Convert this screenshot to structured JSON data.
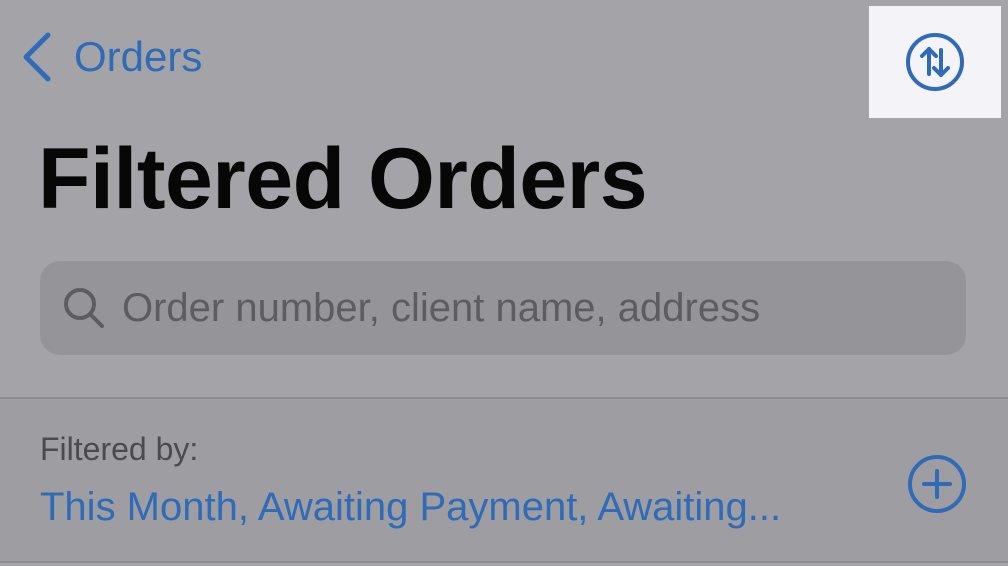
{
  "nav": {
    "back_label": "Orders",
    "back_icon": "chevron-left-icon",
    "sort_icon": "sort-arrows-icon"
  },
  "page": {
    "title": "Filtered Orders"
  },
  "search": {
    "placeholder": "Order number, client name, address",
    "value": "",
    "icon": "search-icon"
  },
  "filters": {
    "caption": "Filtered by:",
    "values": "This Month, Awaiting Payment, Awaiting...",
    "add_icon": "plus-circle-icon"
  },
  "colors": {
    "accent": "#2f6bb7",
    "background": "#a3a3a8",
    "title": "#070707"
  }
}
